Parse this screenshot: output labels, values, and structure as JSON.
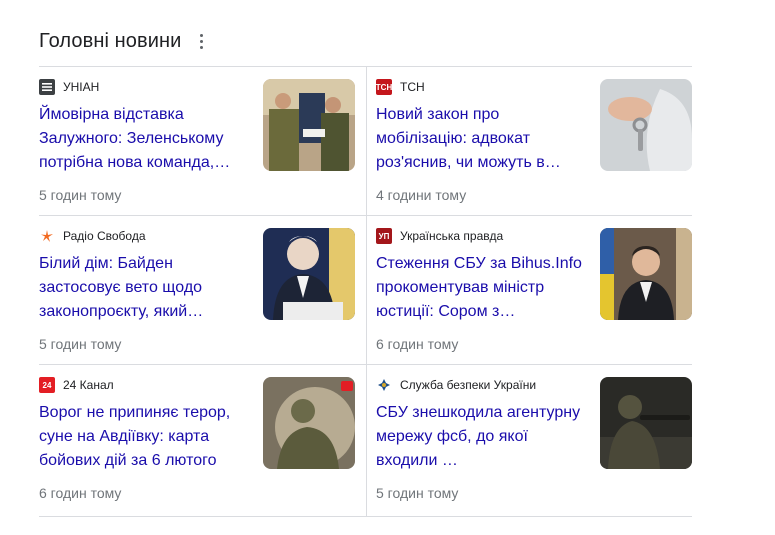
{
  "header": {
    "title": "Головні новини"
  },
  "cards": [
    {
      "source": "УНІАН",
      "headline": "Ймовірна відставка Залужного: Зеленському потрібна нова команда,…",
      "time": "5 годин тому"
    },
    {
      "source": "ТСН",
      "headline": "Новий закон про мобілізацію: адвокат роз'яснив, чи можуть в…",
      "time": "4 години тому",
      "icon_text": "TCH"
    },
    {
      "source": "Радіо Свобода",
      "headline": "Білий дім: Байден застосовує вето щодо законопроєкту, який…",
      "time": "5 годин тому"
    },
    {
      "source": "Українська правда",
      "headline": "Стеження СБУ за Bihus.Info прокоментував міністр юстиції: Сором з…",
      "time": "6 годин тому",
      "icon_text": "УП"
    },
    {
      "source": "24 Канал",
      "headline": "Ворог не припиняє терор, суне на Авдіївку: карта бойових дій за 6 лютого",
      "time": "6 годин тому",
      "icon_text": "24"
    },
    {
      "source": "Служба безпеки України",
      "headline": "СБУ знешкодила агентурну мережу фсб, до якої входили …",
      "time": "5 годин тому"
    }
  ],
  "colors": {
    "headline": "#1a0dab",
    "tsn": "#c4161c",
    "up": "#a3161a",
    "channel24": "#e31e24",
    "svoboda": "#f26a21"
  }
}
